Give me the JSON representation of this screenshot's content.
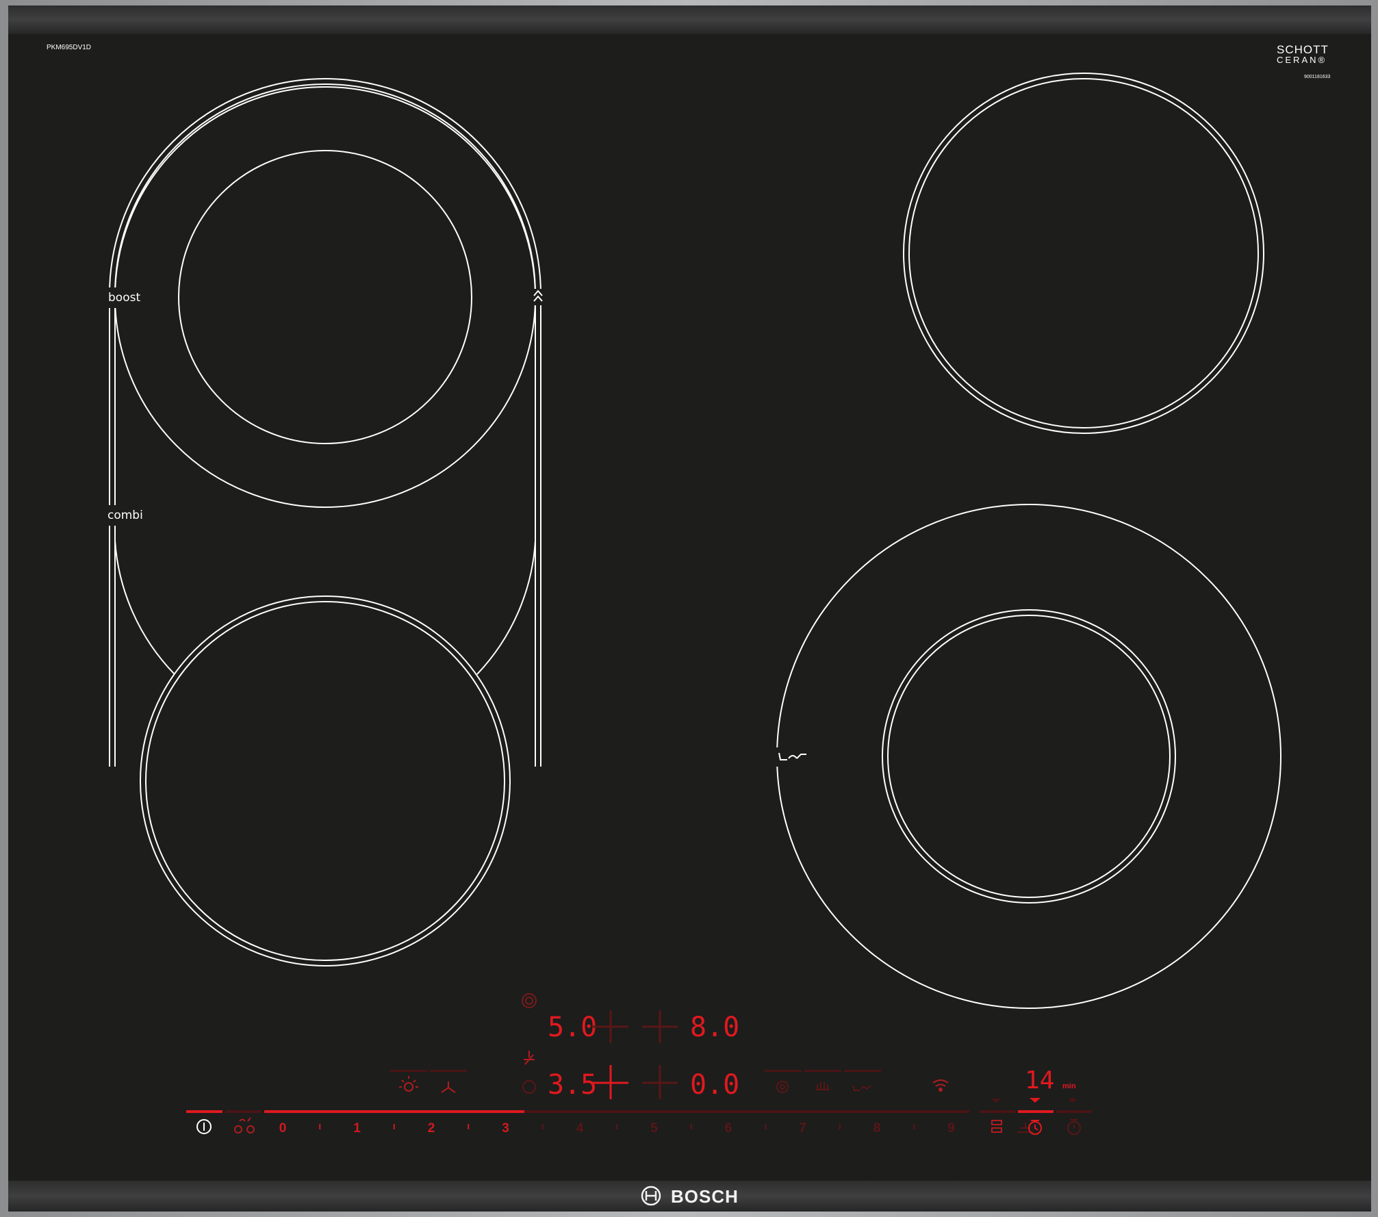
{
  "model": "PKM695DV1D",
  "glass": {
    "brand_line1": "SCHOTT",
    "brand_line2": "CERAN®",
    "code": "9001181633"
  },
  "zones": {
    "boost_label": "boost",
    "combi_label": "combi"
  },
  "displays": {
    "top_left": "5.0",
    "top_right": "8.0",
    "bottom_left": "3.5",
    "bottom_right": "0.0",
    "timer_value": "14",
    "timer_unit": "min"
  },
  "power_scale": {
    "numbers": [
      "0",
      "1",
      "2",
      "3",
      "4",
      "5",
      "6",
      "7",
      "8",
      "9"
    ],
    "lit_numbers": 4
  },
  "brand": "BOSCH",
  "colors": {
    "glass": "#1d1d1c",
    "frame": "#9d9fa0",
    "led_active": "#e0191f",
    "led_inactive": "#4a1414",
    "ring": "#ffffff"
  },
  "icons": {
    "power": "power-icon",
    "child_lock": "child-lock-icon",
    "power_boost": "power-boost-icon",
    "zone_selector": "zone-select-icon",
    "hood_light": "hood-light-icon",
    "hood_fan": "hood-fan-icon",
    "frying_sensor": "frying-sensor-icon",
    "keep_warm": "keep-warm-icon",
    "cooking_sensor": "cooking-sensor-icon",
    "home_connect": "wifi-icon",
    "timer": "timer-icon",
    "stopwatch": "stopwatch-icon"
  }
}
